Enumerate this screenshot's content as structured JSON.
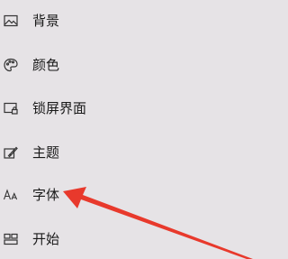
{
  "settings_nav": {
    "items": [
      {
        "id": "background",
        "label": "背景",
        "icon": "picture-icon"
      },
      {
        "id": "colors",
        "label": "颜色",
        "icon": "palette-icon"
      },
      {
        "id": "lock-screen",
        "label": "锁屏界面",
        "icon": "lock-screen-icon"
      },
      {
        "id": "themes",
        "label": "主题",
        "icon": "themes-brush-icon"
      },
      {
        "id": "fonts",
        "label": "字体",
        "icon": "font-icon"
      },
      {
        "id": "start",
        "label": "开始",
        "icon": "start-menu-icon"
      }
    ]
  },
  "annotation": {
    "arrow_color": "#e8392c",
    "points_to": "fonts"
  }
}
